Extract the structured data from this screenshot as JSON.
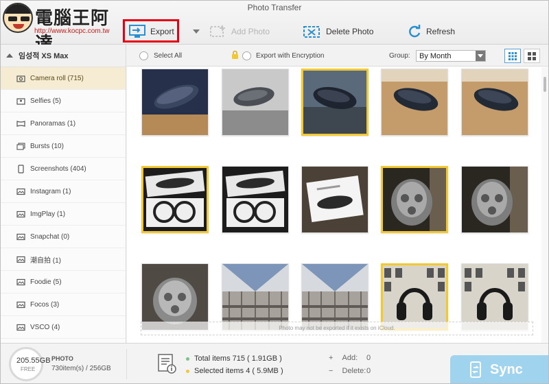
{
  "window": {
    "title": "Photo Transfer"
  },
  "logo": {
    "name": "電腦王阿達",
    "url": "http://www.kocpc.com.tw"
  },
  "toolbar": {
    "export": "Export",
    "add_photo": "Add Photo",
    "delete_photo": "Delete Photo",
    "refresh": "Refresh"
  },
  "sidebar": {
    "device": "임성적 XS Max",
    "items": [
      {
        "label": "Camera roll (715)",
        "icon": "camera-icon"
      },
      {
        "label": "Selfies (5)",
        "icon": "selfie-icon"
      },
      {
        "label": "Panoramas (1)",
        "icon": "panorama-icon"
      },
      {
        "label": "Bursts (10)",
        "icon": "burst-icon"
      },
      {
        "label": "Screenshots (404)",
        "icon": "phone-icon"
      },
      {
        "label": "Instagram (1)",
        "icon": "album-icon"
      },
      {
        "label": "ImgPlay (1)",
        "icon": "album-icon"
      },
      {
        "label": "Snapchat (0)",
        "icon": "album-icon"
      },
      {
        "label": "潮自拍 (1)",
        "icon": "album-icon"
      },
      {
        "label": "Foodie (5)",
        "icon": "album-icon"
      },
      {
        "label": "Focos (3)",
        "icon": "album-icon"
      },
      {
        "label": "VSCO (4)",
        "icon": "album-icon"
      }
    ]
  },
  "selection_bar": {
    "select_all": "Select All",
    "export_encryption": "Export with Encryption",
    "group_label": "Group:",
    "group_value": "By Month"
  },
  "photos": [
    {
      "selected": false,
      "scene": "mouse-blue-wood"
    },
    {
      "selected": false,
      "scene": "mouse-grey-laptop"
    },
    {
      "selected": true,
      "scene": "mouse-dark-desk"
    },
    {
      "selected": false,
      "scene": "mouse-dark-wood"
    },
    {
      "selected": false,
      "scene": "mouse-dark-wood"
    },
    {
      "selected": true,
      "scene": "box-cable"
    },
    {
      "selected": false,
      "scene": "box-cable"
    },
    {
      "selected": false,
      "scene": "box-white"
    },
    {
      "selected": true,
      "scene": "speaker-dark"
    },
    {
      "selected": false,
      "scene": "speaker-dark"
    },
    {
      "selected": false,
      "scene": "speaker-grey"
    },
    {
      "selected": false,
      "scene": "building-interior"
    },
    {
      "selected": false,
      "scene": "building-interior"
    },
    {
      "selected": true,
      "scene": "headphones-store"
    },
    {
      "selected": false,
      "scene": "headphones-store"
    }
  ],
  "notice": "Photo may not be exported if it exists on iCloud.",
  "footer": {
    "free_size": "205.55GB",
    "free_label": "FREE",
    "photo_label": "PHOTO",
    "photo_stat": "730item(s) / 256GB",
    "total_items": "Total items 715 ( 1.91GB )",
    "selected_items": "Selected items 4 ( 5.9MB )",
    "add_label": "Add:",
    "add_value": "0",
    "delete_label": "Delete:",
    "delete_value": "0",
    "sync": "Sync"
  },
  "colors": {
    "accent_blue": "#2a8fd0",
    "selected_border": "#f3c933",
    "export_highlight": "#e60012",
    "sync_button": "#9fd3ee",
    "active_sidebar": "#f5ecd3"
  }
}
